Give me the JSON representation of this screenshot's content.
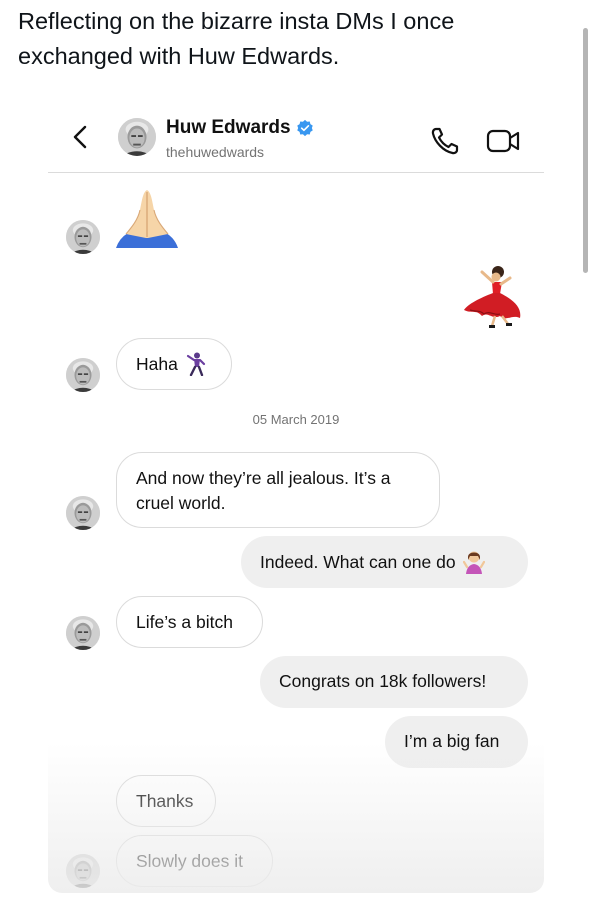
{
  "post": {
    "text": "Reflecting on the bizarre insta DMs I once exchanged with Huw Edwards."
  },
  "chat_header": {
    "display_name": "Huw Edwards",
    "username": "thehuwedwards",
    "back_icon": "chevron-left-icon",
    "verified_icon": "verified-badge-icon",
    "call_icon": "phone-icon",
    "video_icon": "video-camera-icon",
    "verified_color": "#3897f0"
  },
  "messages": [
    {
      "from": "them",
      "type": "emoji",
      "emoji": "folded-hands"
    },
    {
      "from": "me",
      "type": "emoji",
      "emoji": "flamenco-dancer"
    },
    {
      "from": "them",
      "type": "text",
      "text": "Haha",
      "emoji": "man-dancing"
    },
    {
      "from": "them",
      "type": "text",
      "text": "And now they’re all jealous. It’s a cruel world."
    },
    {
      "from": "me",
      "type": "text",
      "text": "Indeed. What can one do",
      "emoji": "woman-shrugging"
    },
    {
      "from": "them",
      "type": "text",
      "text": "Life’s a bitch"
    },
    {
      "from": "me",
      "type": "text",
      "text": "Congrats on 18k followers!"
    },
    {
      "from": "me",
      "type": "text",
      "text": "I’m a big fan"
    },
    {
      "from": "them",
      "type": "text",
      "text": "Thanks"
    },
    {
      "from": "them",
      "type": "text",
      "text": "Slowly does it"
    }
  ],
  "date_separator": "05 March 2019",
  "colors": {
    "incoming_bubble": "#ffffff",
    "outgoing_bubble": "#efefef",
    "secondary_text": "#737373"
  }
}
